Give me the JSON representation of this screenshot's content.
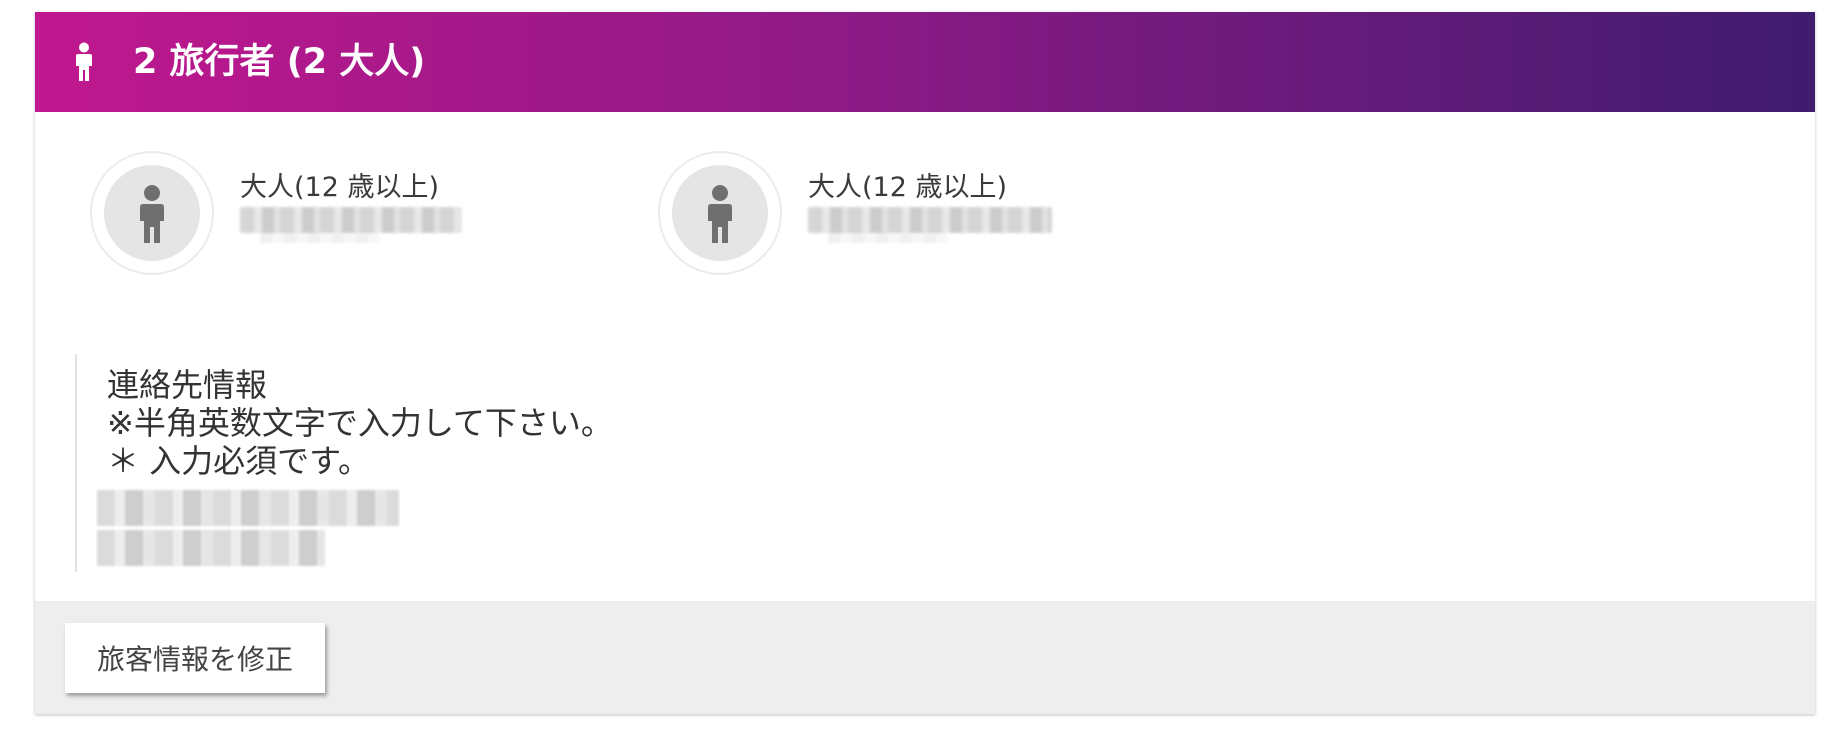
{
  "header": {
    "title": "2 旅行者 (2 大人)",
    "icon": "person-icon",
    "gradient_start": "#c0188e",
    "gradient_end": "#3f1c6e"
  },
  "travelers": [
    {
      "type": "大人(12 歳以上)",
      "avatar_icon": "person-icon"
    },
    {
      "type": "大人(12 歳以上)",
      "avatar_icon": "person-icon"
    }
  ],
  "contact": {
    "title": "連絡先情報",
    "note": "※半角英数文字で入力して下さい。",
    "required": "＊ 入力必須です。"
  },
  "footer": {
    "edit_label": "旅客情報を修正"
  }
}
